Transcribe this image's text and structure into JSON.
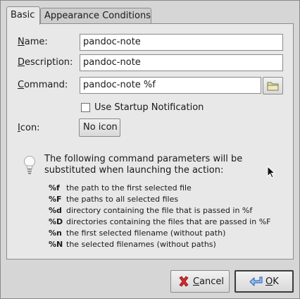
{
  "tabs": [
    "Basic",
    "Appearance Conditions"
  ],
  "form": {
    "name_label_u": "N",
    "name_label_rest": "ame:",
    "name_value": "pandoc-note",
    "description_label_u": "D",
    "description_label_rest": "escription:",
    "description_value": "pandoc-note",
    "command_label_u": "C",
    "command_label_rest": "ommand:",
    "command_value": "pandoc-note %f",
    "startup_label": "Use Startup Notification",
    "icon_label_u": "I",
    "icon_label_rest": "con:",
    "icon_button": "No icon"
  },
  "info": {
    "text": "The following command parameters will be substituted when launching the action:"
  },
  "params": [
    {
      "key": "%f",
      "desc": "the path to the first selected file"
    },
    {
      "key": "%F",
      "desc": "the paths to all selected files"
    },
    {
      "key": "%d",
      "desc": "directory containing the file that is passed in %f"
    },
    {
      "key": "%D",
      "desc": "directories containing the files that are passed in %F"
    },
    {
      "key": "%n",
      "desc": "the first selected filename (without path)"
    },
    {
      "key": "%N",
      "desc": "the selected filenames (without paths)"
    }
  ],
  "buttons": {
    "cancel_u": "C",
    "cancel_rest": "ancel",
    "ok_u": "O",
    "ok_rest": "K"
  },
  "icons": {
    "folder": "folder-icon",
    "bulb": "lightbulb-icon",
    "cancel": "cancel-x-icon",
    "ok": "ok-arrow-icon",
    "pointer": "mouse-pointer-icon"
  },
  "colors": {
    "window_bg": "#d6d6d6",
    "panel_bg": "#e8e8e8",
    "cancel_icon": "#d22b2b",
    "ok_icon": "#3a6fc4"
  }
}
